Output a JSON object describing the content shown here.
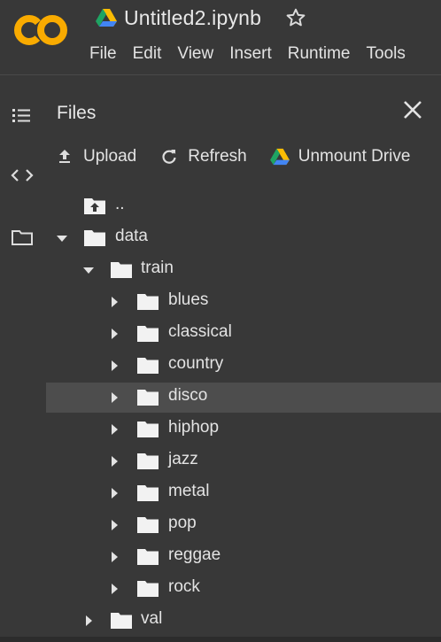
{
  "header": {
    "logo_text": "CO",
    "title": "Untitled2.ipynb",
    "menu": [
      "File",
      "Edit",
      "View",
      "Insert",
      "Runtime",
      "Tools"
    ]
  },
  "panel": {
    "title": "Files",
    "actions": {
      "upload": "Upload",
      "refresh": "Refresh",
      "unmount": "Unmount Drive"
    }
  },
  "tree": {
    "parent": "..",
    "data": "data",
    "train": "train",
    "genres": [
      "blues",
      "classical",
      "country",
      "disco",
      "hiphop",
      "jazz",
      "metal",
      "pop",
      "reggae",
      "rock"
    ],
    "selected": "disco",
    "val": "val"
  },
  "colors": {
    "background": "#383838",
    "selected_row": "#4d4d4d",
    "logo_orange": "#f9ab00",
    "text": "#e3e3e3"
  },
  "icons": {
    "rail": [
      "table-of-contents-icon",
      "code-snippets-icon",
      "files-folder-icon"
    ],
    "star": "star-outline-icon",
    "close": "close-icon"
  }
}
